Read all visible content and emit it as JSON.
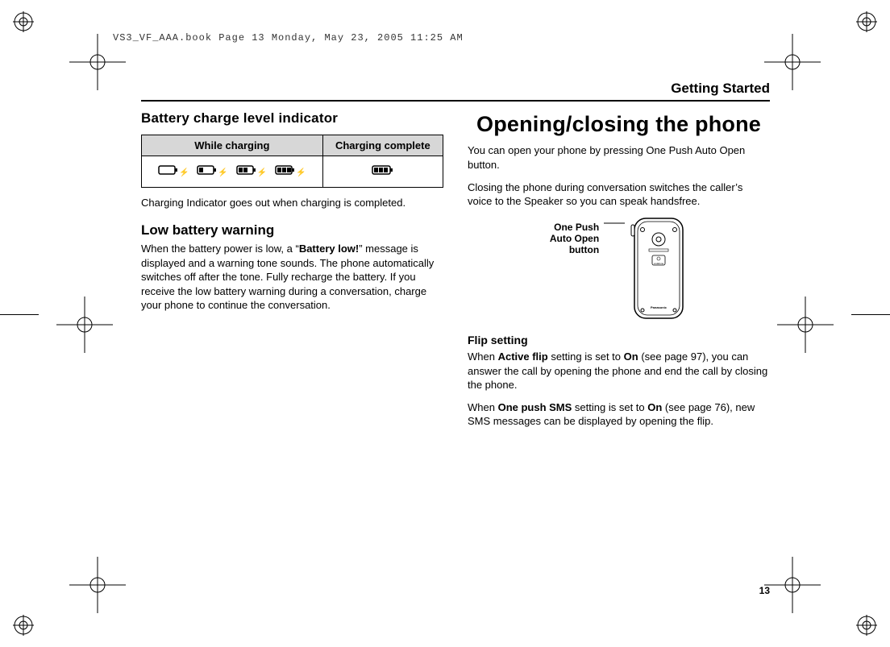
{
  "stamp": "VS3_VF_AAA.book  Page 13  Monday, May 23, 2005  11:25 AM",
  "running_head": "Getting Started",
  "page_number": "13",
  "left": {
    "h_battery_indicator": "Battery charge level indicator",
    "th_while_charging": "While charging",
    "th_charging_complete": "Charging complete",
    "p_indicator_note": "Charging Indicator goes out when charging is completed.",
    "h_low_battery": "Low battery warning",
    "p_low_battery_1": "When the battery power is low, a “",
    "p_low_battery_bold": "Battery low!",
    "p_low_battery_2": "” message is displayed and a warning tone sounds. The phone automatically switches off after the tone. Fully recharge the battery. If you receive the low battery warning during a conversation, charge your phone to continue the conversation."
  },
  "right": {
    "h_open_close": "Opening/closing the phone",
    "p_open": "You can open your phone by pressing One Push Auto Open button.",
    "p_close": "Closing the phone during conversation switches the caller’s voice to the Speaker so you can speak handsfree.",
    "callout_l1": "One Push",
    "callout_l2": "Auto Open",
    "callout_l3": "button",
    "h_flip": "Flip setting",
    "p_flip_a1": "When ",
    "p_flip_a_b1": "Active flip",
    "p_flip_a2": " setting is set to ",
    "p_flip_a_b2": "On",
    "p_flip_a3": " (see page 97), you can answer the call by opening the phone and end the call by closing the phone.",
    "p_flip_b1": "When ",
    "p_flip_b_b1": "One push SMS",
    "p_flip_b2": " setting is set to ",
    "p_flip_b_b2": "On",
    "p_flip_b3": " (see page 76), new SMS messages can be displayed by opening the flip."
  }
}
